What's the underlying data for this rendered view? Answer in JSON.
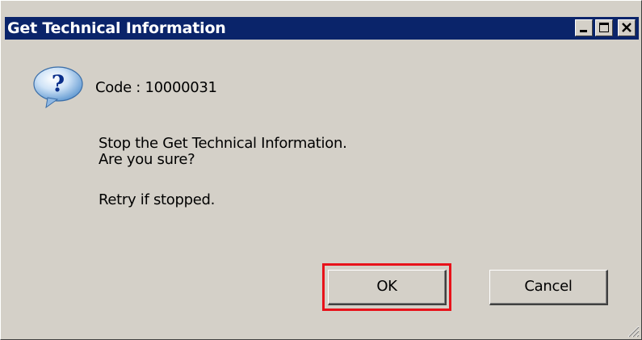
{
  "window": {
    "title": "Get Technical Information",
    "controls": {
      "minimize": "minimize-icon",
      "maximize": "maximize-icon",
      "close": "close-icon"
    }
  },
  "dialog": {
    "icon": "question-icon",
    "code_line": "Code : 10000031",
    "message_line1": "Stop the Get Technical Information.",
    "message_line2": "Are you sure?",
    "message_line3": "Retry if stopped."
  },
  "buttons": {
    "ok_label": "OK",
    "cancel_label": "Cancel"
  },
  "colors": {
    "titlebar": "#0a246a",
    "window_face": "#d4d0c8",
    "highlight": "#e8121a",
    "icon_bubble": "#6ea8dc"
  }
}
